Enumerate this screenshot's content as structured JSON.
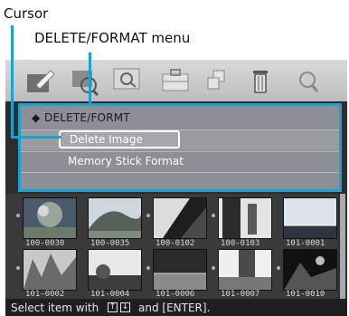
{
  "callouts": {
    "cursor": "Cursor",
    "menu": "DELETE/FORMAT menu"
  },
  "toolbar": {
    "icons": [
      "edit-icon",
      "search-zoom-icon",
      "magnifier-icon",
      "toolbox-icon",
      "copy-icon",
      "trash-icon",
      "search-icon"
    ]
  },
  "menu": {
    "title_marker": "◆",
    "title": "DELETE/FORMT",
    "items": [
      {
        "label": "Delete Image",
        "selected": true
      },
      {
        "label": "Memory Stick Format",
        "selected": false
      }
    ]
  },
  "thumbnails": [
    {
      "label": "100-0030"
    },
    {
      "label": "100-0035"
    },
    {
      "label": "100-0102"
    },
    {
      "label": "100-0103"
    },
    {
      "label": "101-0001"
    },
    {
      "label": "101-0002"
    },
    {
      "label": "101-0004"
    },
    {
      "label": "101-0006"
    },
    {
      "label": "101-0007"
    },
    {
      "label": "101-0010"
    }
  ],
  "status": {
    "prefix": "Select item with",
    "key_up": "↑",
    "key_down": "↓",
    "suffix": "and [ENTER]."
  },
  "colors": {
    "accent": "#1aa3cf",
    "menu_bg": "#8e8f96",
    "screen_bg": "#2d2d2f"
  }
}
